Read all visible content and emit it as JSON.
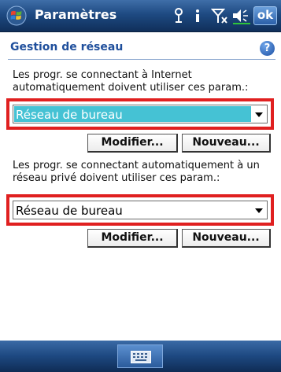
{
  "titlebar": {
    "title": "Paramètres",
    "ok_label": "ok",
    "icons": [
      "windows-start-icon",
      "connectivity-icon",
      "info-icon",
      "signal-icon",
      "volume-icon"
    ]
  },
  "section": {
    "title": "Gestion de réseau",
    "help_label": "?"
  },
  "internet": {
    "description": "Les progr. se connectant à Internet automatiquement doivent utiliser ces param.:",
    "selected_value": "Réseau de bureau",
    "modify_label": "Modifier...",
    "new_label": "Nouveau..."
  },
  "private": {
    "description": "Les progr. se connectant automatiquement à un réseau privé doivent utiliser ces param.:",
    "selected_value": "Réseau de bureau",
    "modify_label": "Modifier...",
    "new_label": "Nouveau..."
  },
  "colors": {
    "titlebar": "#1e4a82",
    "section_title": "#1f4f9c",
    "highlight_border": "#e02020",
    "selection": "#45c2d4"
  }
}
